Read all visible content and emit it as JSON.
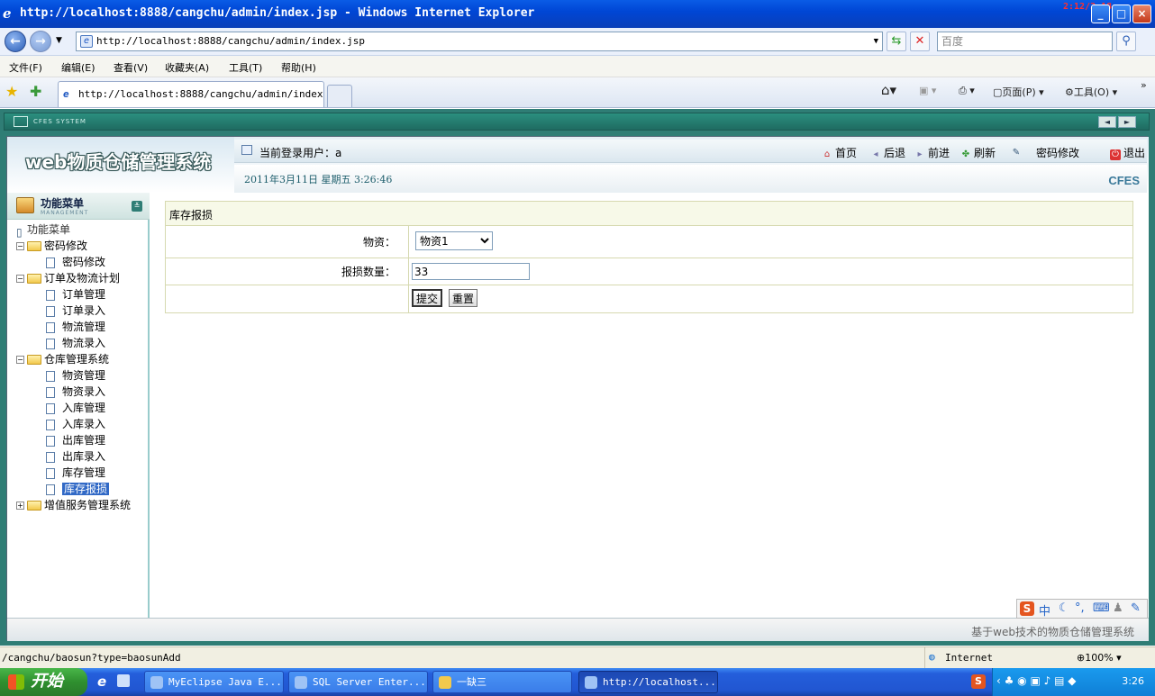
{
  "window": {
    "title": "http://localhost:8888/cangchu/admin/index.jsp - Windows Internet Explorer",
    "stamp": "2:12/2:18",
    "controls": {
      "minimize": "_",
      "maximize": "□",
      "close": "×"
    }
  },
  "addressbar": {
    "url": "http://localhost:8888/cangchu/admin/index.jsp",
    "search_placeholder": "百度"
  },
  "menu": [
    "文件(F)",
    "编辑(E)",
    "查看(V)",
    "收藏夹(A)",
    "工具(T)",
    "帮助(H)"
  ],
  "tab": {
    "label": "http://localhost:8888/cangchu/admin/index..."
  },
  "toolbar": {
    "page_label": "页面(P)",
    "tools_label": "工具(O)"
  },
  "app": {
    "frame_label": "CFES SYSTEM",
    "logo": "web物质仓储管理系统",
    "current_user": "当前登录用户：a",
    "datetime": "2011年3月11日  星期五  3:26:46",
    "brand": "CFES",
    "top_links": {
      "home": "首页",
      "back": "后退",
      "forward": "前进",
      "refresh": "刷新",
      "change_pwd": "密码修改",
      "logout": "退出"
    },
    "footer": "基于web技术的物质仓储管理系统"
  },
  "sidebar": {
    "title": "功能菜单",
    "subtitle": "MANAGEMENT",
    "root": "功能菜单",
    "groups": [
      {
        "label": "密码修改",
        "items": [
          "密码修改"
        ]
      },
      {
        "label": "订单及物流计划",
        "items": [
          "订单管理",
          "订单录入",
          "物流管理",
          "物流录入"
        ]
      },
      {
        "label": "仓库管理系统",
        "items": [
          "物资管理",
          "物资录入",
          "入库管理",
          "入库录入",
          "出库管理",
          "出库录入",
          "库存管理",
          "库存报损"
        ]
      },
      {
        "label": "增值服务管理系统",
        "items": []
      }
    ],
    "selected": "库存报损"
  },
  "form": {
    "caption": "库存报损",
    "material_label": "物资：",
    "material_value": "物资1",
    "qty_label": "报损数量：",
    "qty_value": "33",
    "submit": "提交",
    "reset": "重置"
  },
  "ime": {
    "zh": "中"
  },
  "statusbar": {
    "text": "/cangchu/baosun?type=baosunAdd",
    "zone": "Internet",
    "zoom": "100%"
  },
  "taskbar": {
    "start": "开始",
    "items": [
      "MyEclipse Java E...",
      "SQL Server Enter...",
      "一缺三",
      "http://localhost..."
    ],
    "clock": "3:26"
  }
}
